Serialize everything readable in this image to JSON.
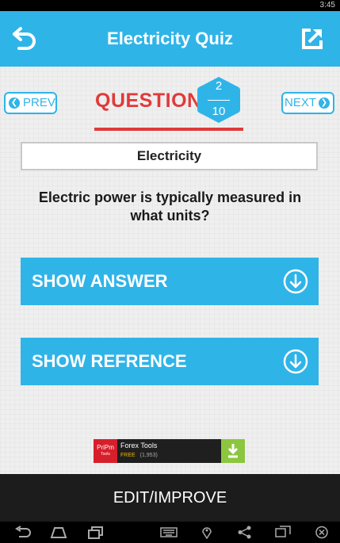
{
  "status_bar": {
    "time": "3:45"
  },
  "app_bar": {
    "title": "Electricity Quiz",
    "back_icon": "back-arrow-icon",
    "share_icon": "share-icon"
  },
  "navigation": {
    "prev_label": "PREV",
    "next_label": "NEXT"
  },
  "question_header": {
    "label": "QUESTION",
    "current": "2",
    "total": "10"
  },
  "category": "Electricity",
  "question": "Electric power is typically measured in what units?",
  "buttons": {
    "show_answer": "SHOW ANSWER",
    "show_refrence": "SHOW REFRENCE"
  },
  "ad": {
    "logo_text": "PriPm",
    "logo_sub": "Tools",
    "title": "Forex Tools",
    "price": "FREE",
    "rating_count": "(1,953)"
  },
  "footer": {
    "edit_label": "EDIT/IMPROVE"
  },
  "colors": {
    "accent": "#2fb4e8",
    "question_red": "#e03a3a",
    "footer": "#1c1c1c",
    "ad_green": "#8cc63f"
  }
}
